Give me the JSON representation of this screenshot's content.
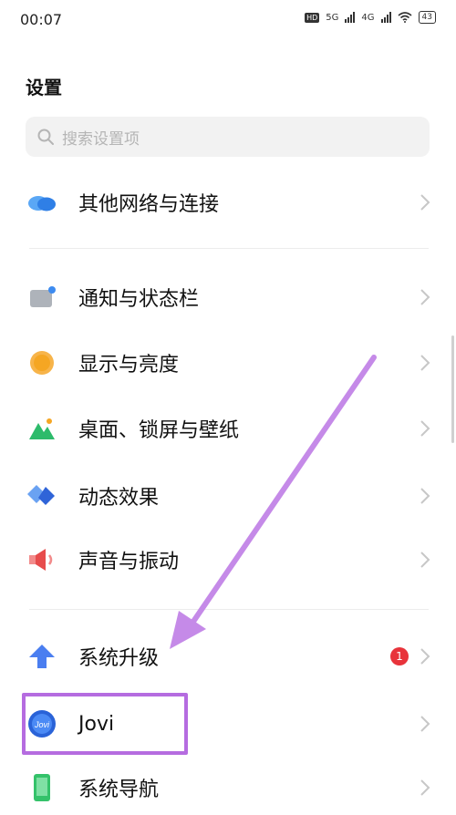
{
  "status_bar": {
    "time": "00:07",
    "hd": "HD",
    "network_1": "5G",
    "network_2": "4G",
    "battery": "43"
  },
  "page": {
    "title": "设置"
  },
  "search": {
    "placeholder": "搜索设置项"
  },
  "settings_items": [
    {
      "label": "其他网络与连接",
      "icon": "cloud-network-icon",
      "color": "#3d8bf0"
    },
    {
      "label": "通知与状态栏",
      "icon": "notification-icon",
      "color": "#9aa0a8"
    },
    {
      "label": "显示与亮度",
      "icon": "brightness-icon",
      "color": "#f5a623"
    },
    {
      "label": "桌面、锁屏与壁纸",
      "icon": "wallpaper-icon",
      "color": "#2dbb6b"
    },
    {
      "label": "动态效果",
      "icon": "dynamic-effect-icon",
      "color": "#3a74e6"
    },
    {
      "label": "声音与振动",
      "icon": "sound-icon",
      "color": "#ee5a5a"
    },
    {
      "label": "系统升级",
      "icon": "upgrade-arrow-icon",
      "color": "#4a7ef0",
      "badge": "1"
    },
    {
      "label": "Jovi",
      "icon": "jovi-icon",
      "color": "#2a63d8"
    },
    {
      "label": "系统导航",
      "icon": "phone-navigation-icon",
      "color": "#34c26a"
    }
  ],
  "annotation": {
    "highlight_color": "#b56ce0"
  }
}
